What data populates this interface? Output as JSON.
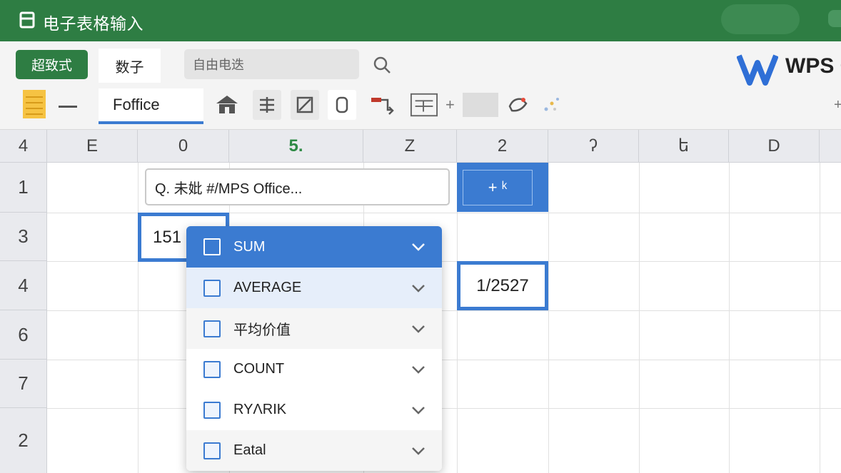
{
  "titlebar": {
    "title": "电子表格输入"
  },
  "toolbar": {
    "primary_button": "超致式",
    "active_tab": "数子",
    "search_placeholder": "自由电迭",
    "file_tab": "Foffice",
    "brand": "WPS O"
  },
  "grid": {
    "columns": [
      "4",
      "E",
      "0",
      "5.",
      "Z",
      "2",
      "ʔ",
      "ե",
      "D"
    ],
    "rows": [
      "1",
      "3",
      "4",
      "6",
      "7",
      "2"
    ],
    "formula_text": "Q. 未妣 #/MPS Office...",
    "button_cell": "+ ᵏ",
    "selected_value": "151",
    "result_value": "1/2527"
  },
  "dropdown": {
    "items": [
      {
        "label": "SUM"
      },
      {
        "label": "AVERAGE"
      },
      {
        "label": "平均价值"
      },
      {
        "label": "COUNT"
      },
      {
        "label": "RYΛRIK"
      },
      {
        "label": "Eatal"
      }
    ]
  },
  "colors": {
    "brand_green": "#2e7d43",
    "accent_blue": "#3b7bd1"
  }
}
